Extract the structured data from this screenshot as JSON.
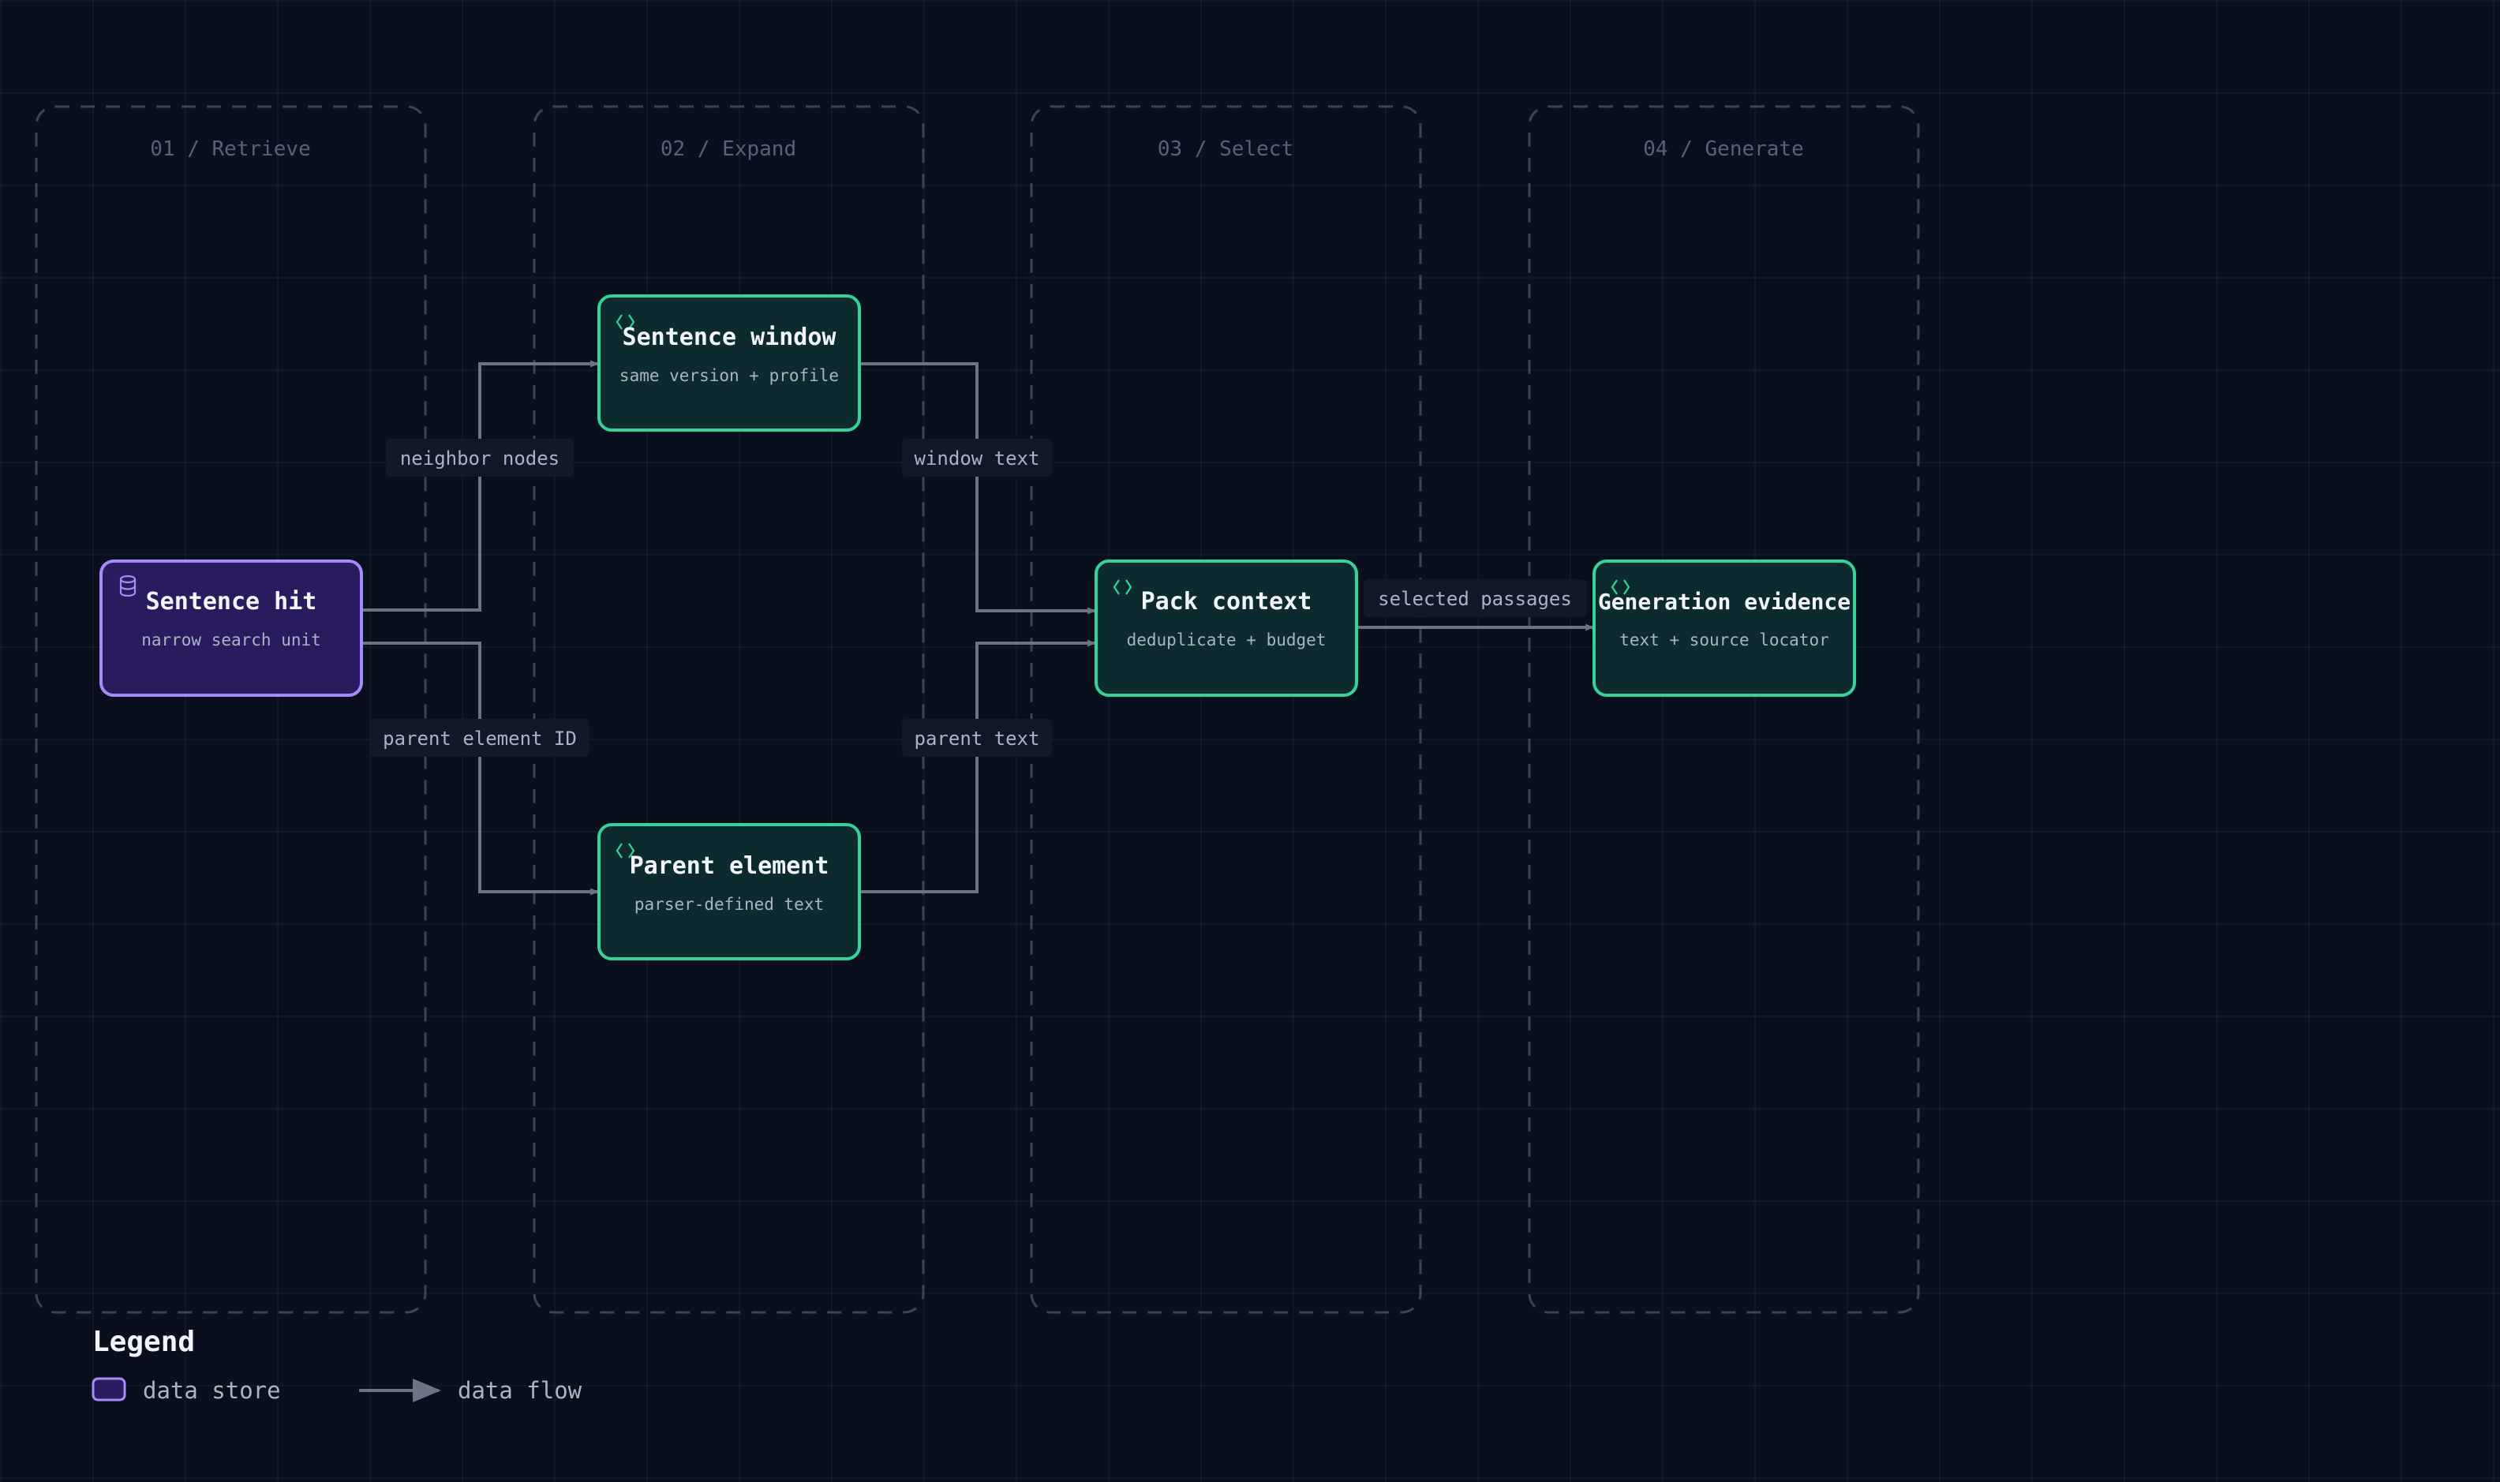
{
  "lanes": [
    {
      "label": "01 / Retrieve"
    },
    {
      "label": "02 / Expand"
    },
    {
      "label": "03 / Select"
    },
    {
      "label": "04 / Generate"
    }
  ],
  "nodes": {
    "sentence_hit": {
      "title": "Sentence hit",
      "subtitle": "narrow search unit",
      "icon": "database-icon"
    },
    "sentence_window": {
      "title": "Sentence window",
      "subtitle": "same version + profile",
      "icon": "code-icon"
    },
    "parent_element": {
      "title": "Parent element",
      "subtitle": "parser-defined text",
      "icon": "code-icon"
    },
    "pack_context": {
      "title": "Pack context",
      "subtitle": "deduplicate + budget",
      "icon": "code-icon"
    },
    "generation_evidence": {
      "title": "Generation evidence",
      "subtitle": "text + source locator",
      "icon": "code-icon"
    }
  },
  "edges": {
    "neighbor_nodes": "neighbor nodes",
    "parent_element_id": "parent element ID",
    "window_text": "window text",
    "parent_text": "parent text",
    "selected_passages": "selected passages"
  },
  "legend": {
    "title": "Legend",
    "items": [
      {
        "label": "data store"
      },
      {
        "label": "data flow"
      }
    ]
  },
  "colors": {
    "background": "#0a0f1e",
    "store_fill": "#2a1a5e",
    "store_stroke": "#a78bfa",
    "process_fill": "#0d2b2e",
    "process_stroke": "#34d399",
    "edge": "#64748b"
  }
}
